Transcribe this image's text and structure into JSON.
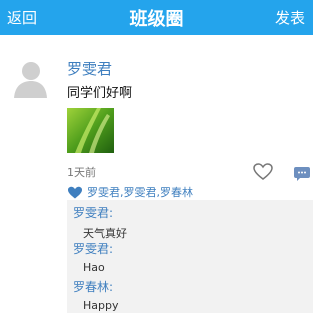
{
  "header": {
    "back_label": "返回",
    "title": "班级圈",
    "publish_label": "发表",
    "bg_color": "#24a4ec"
  },
  "post": {
    "author": "罗雯君",
    "text": "同学们好啊",
    "time": "1天前",
    "likers": "罗雯君,罗雯君,罗春林",
    "comments": [
      {
        "author": "罗雯君:",
        "text": "天气真好"
      },
      {
        "author": "罗雯君:",
        "text": "Hao"
      },
      {
        "author": "罗春林:",
        "text": "Happy"
      }
    ]
  },
  "icons": {
    "avatar": "avatar-icon",
    "like": "heart-outline-icon",
    "comment": "comment-bubble-icon",
    "liked": "heart-filled-icon"
  },
  "colors": {
    "name": "#3f7fbf",
    "accent": "#24a4ec",
    "comment_bg": "#f2f2f2"
  }
}
